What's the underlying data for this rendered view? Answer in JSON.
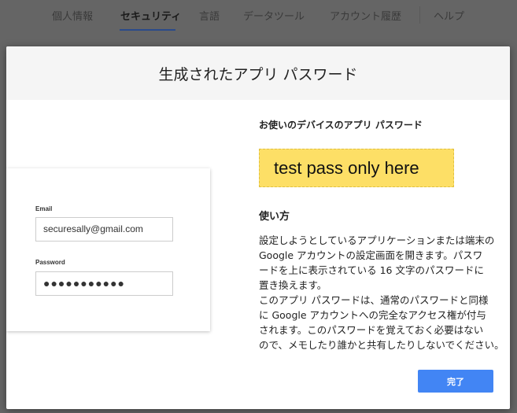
{
  "nav": {
    "items": [
      "個人情報",
      "セキュリティ",
      "言語",
      "データツール",
      "アカウント履歴",
      "ヘルプ"
    ],
    "active": "セキュリティ"
  },
  "dialog": {
    "title": "生成されたアプリ パスワード",
    "illustration": {
      "email_label": "Email",
      "email_value": "securesally@gmail.com",
      "password_label": "Password",
      "password_value": "●●●●●●●●●●●"
    },
    "password_heading": "お使いのデバイスのアプリ パスワード",
    "password": "test pass only here",
    "howto_heading": "使い方",
    "howto_lines": [
      "設定しようとしているアプリケーションまたは端末の",
      "Google アカウントの設定画面を開きます。パスワ",
      "ードを上に表示されている 16 文字のパスワードに",
      "置き換えます。",
      "このアプリ パスワードは、通常のパスワードと同様",
      "に Google アカウントへの完全なアクセス権が付与",
      "されます。このパスワードを覚えておく必要はない",
      "ので、メモしたり誰かと共有したりしないでください。"
    ],
    "done_label": "完了"
  },
  "colors": {
    "accent": "#4285f4",
    "password_bg": "#fddf66"
  }
}
